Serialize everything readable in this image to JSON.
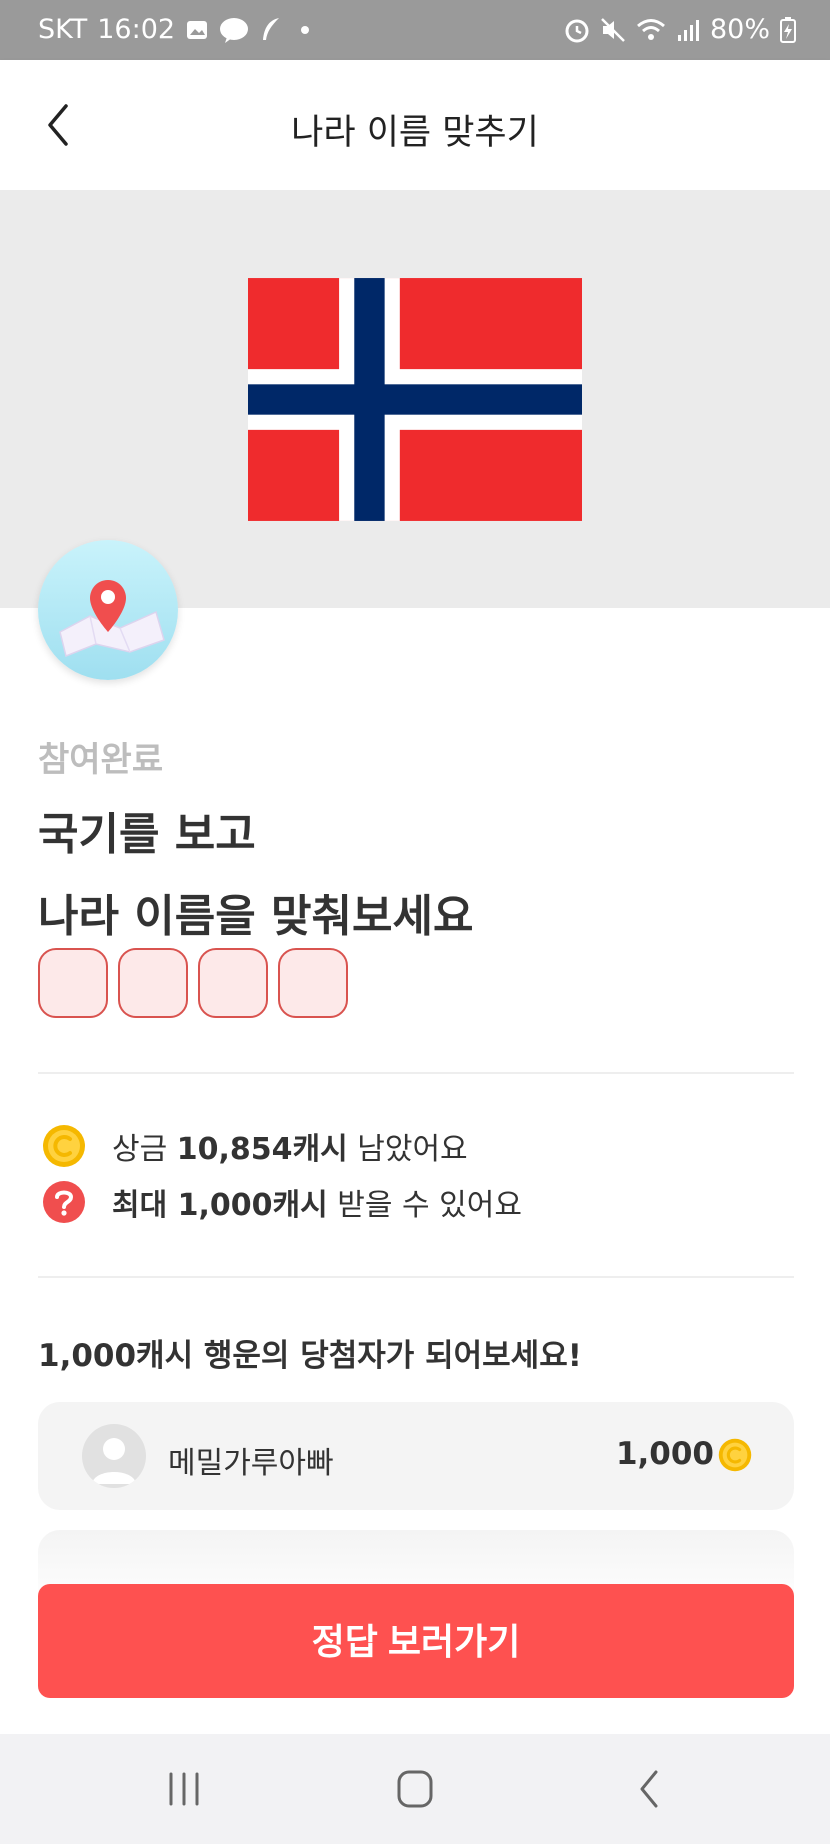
{
  "status_bar": {
    "carrier": "SKT",
    "time": "16:02",
    "battery": "80%"
  },
  "header": {
    "title": "나라 이름 맞추기"
  },
  "quiz": {
    "status_label": "참여완료",
    "question_line1": "국기를 보고",
    "question_line2": "나라 이름을 맞춰보세요",
    "answer_box_count": 4
  },
  "info": {
    "prize_prefix": "상금 ",
    "prize_amount": "10,854캐시",
    "prize_suffix": " 남았어요",
    "max_prefix": "최대 ",
    "max_amount": "1,000캐시",
    "max_suffix": " 받을 수 있어요"
  },
  "winners": {
    "title": "1,000캐시 행운의 당첨자가 되어보세요!",
    "items": [
      {
        "name": "메밀가루아빠",
        "amount": "1,000"
      }
    ]
  },
  "cta": {
    "label": "정답 보러가기"
  },
  "colors": {
    "accent": "#fe5150",
    "coin": "#f5b800",
    "flag_red": "#ef2b2d",
    "flag_blue": "#002868"
  }
}
